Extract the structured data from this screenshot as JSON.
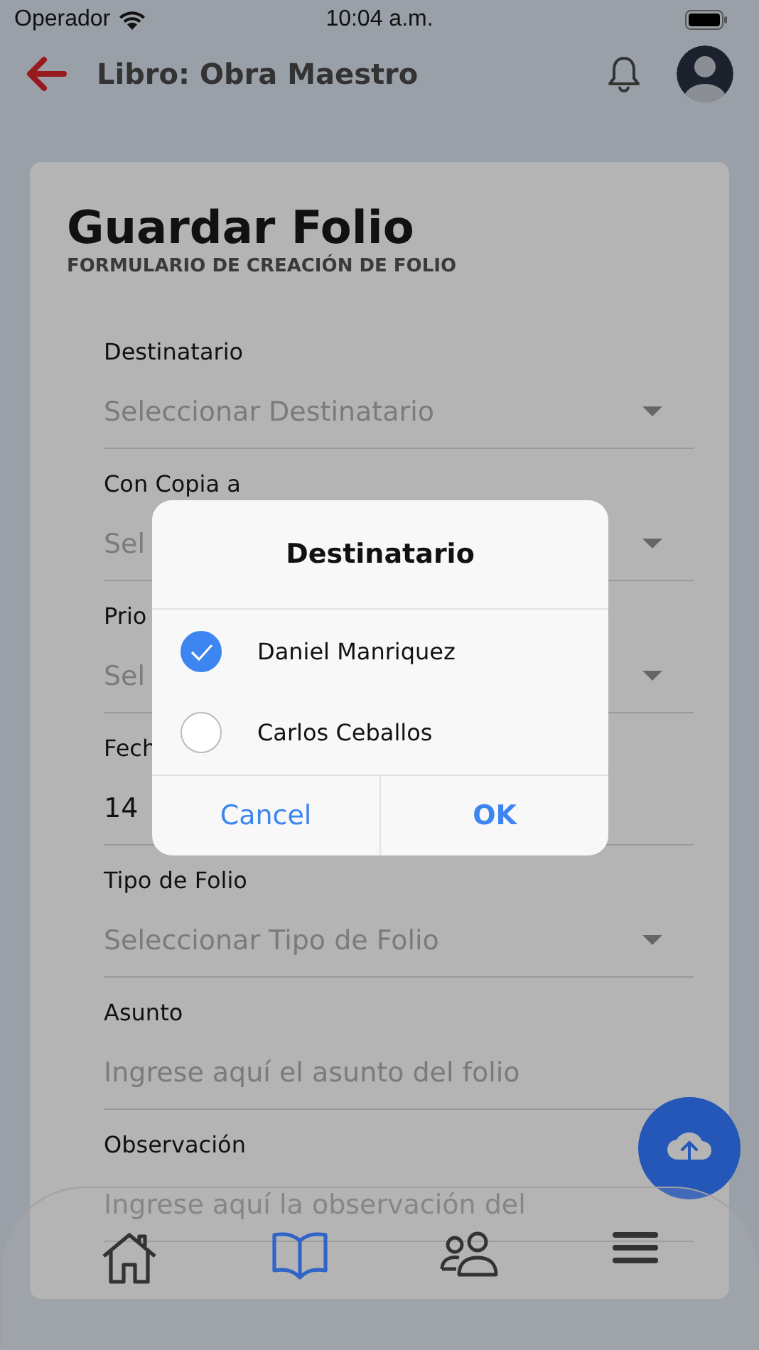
{
  "status_bar": {
    "carrier": "Operador",
    "time": "10:04 a.m."
  },
  "header": {
    "title": "Libro: Obra Maestro"
  },
  "form": {
    "title": "Guardar Folio",
    "subtitle": "FORMULARIO DE CREACIÓN DE FOLIO",
    "fields": [
      {
        "kind": "dropdown",
        "label": "Destinatario",
        "placeholder": "Seleccionar Destinatario"
      },
      {
        "kind": "dropdown",
        "label": "Con Copia a",
        "placeholder": "Sel"
      },
      {
        "kind": "dropdown",
        "label": "Prio",
        "placeholder": "Sel"
      },
      {
        "kind": "text",
        "label": "Fech",
        "value": "14"
      },
      {
        "kind": "dropdown",
        "label": "Tipo de Folio",
        "placeholder": "Seleccionar Tipo de Folio"
      },
      {
        "kind": "text",
        "label": "Asunto",
        "placeholder": "Ingrese aquí el asunto del folio"
      },
      {
        "kind": "text",
        "label": "Observación",
        "placeholder": "Ingrese aquí la observación del"
      }
    ]
  },
  "dialog": {
    "title": "Destinatario",
    "options": [
      {
        "label": "Daniel Manriquez",
        "selected": true
      },
      {
        "label": "Carlos Ceballos",
        "selected": false
      }
    ],
    "buttons": [
      {
        "label": "Cancel",
        "kind": "cancel"
      },
      {
        "label": "OK",
        "kind": "ok"
      }
    ]
  },
  "bottom_nav": [
    {
      "selected": false
    },
    {
      "selected": true
    },
    {
      "selected": false
    },
    {
      "selected": false
    }
  ]
}
